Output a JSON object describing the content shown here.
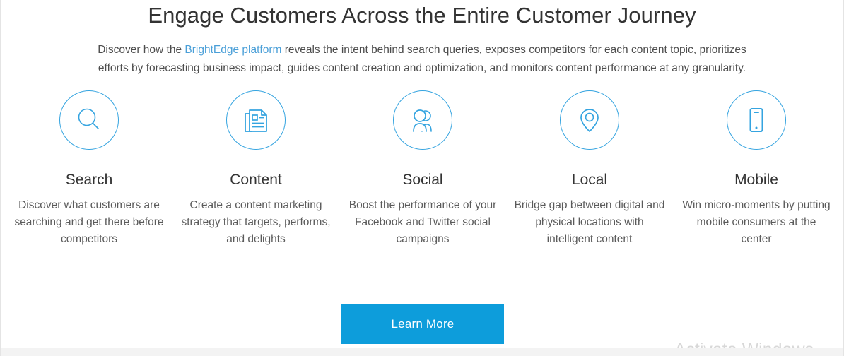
{
  "hero": {
    "heading": "Engage Customers Across the Entire Customer Journey",
    "sub_before_link": "Discover how the ",
    "link_text": "BrightEdge platform",
    "sub_after_link": " reveals the intent behind search queries, exposes competitors for each content topic, prioritizes efforts by forecasting business impact, guides content creation and optimization, and monitors content performance at any granularity."
  },
  "columns": [
    {
      "icon": "search-icon",
      "title": "Search",
      "description": "Discover what customers are searching and get there before competitors"
    },
    {
      "icon": "content-document-icon",
      "title": "Content",
      "description": "Create a content marketing strategy that targets, performs, and delights"
    },
    {
      "icon": "social-people-icon",
      "title": "Social",
      "description": "Boost the performance of your Facebook and Twitter social campaigns"
    },
    {
      "icon": "local-map-pin-icon",
      "title": "Local",
      "description": "Bridge gap between digital and physical locations with intelligent content"
    },
    {
      "icon": "mobile-phone-icon",
      "title": "Mobile",
      "description": "Win micro-moments by putting mobile consumers at the center"
    }
  ],
  "cta": {
    "label": "Learn More"
  },
  "watermark": {
    "text": "Activate Windows"
  },
  "colors": {
    "accent_blue": "#35a4e0",
    "button_blue": "#0d9ddb",
    "link_blue": "#4a9fd8",
    "heading_text": "#333333",
    "body_text": "#5a5a5a",
    "bottom_bar": "#f3f3f3"
  }
}
